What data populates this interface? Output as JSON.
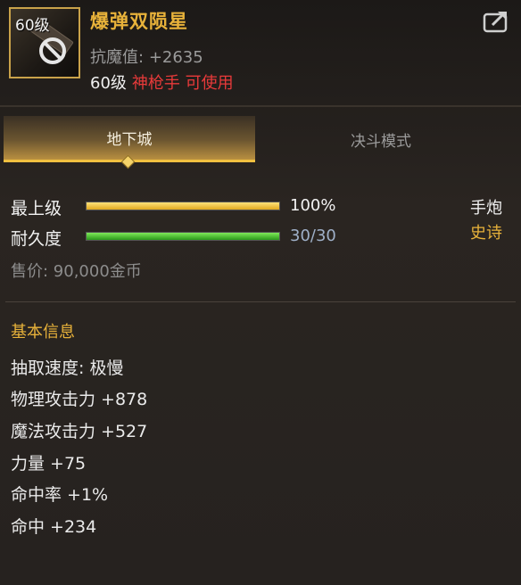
{
  "item": {
    "level_badge": "60级",
    "name": "爆弹双陨星",
    "resist_label": "抗魔值:",
    "resist_value": "+2635",
    "req_level": "60级",
    "req_class": "神枪手 可使用"
  },
  "tabs": [
    {
      "label": "地下城",
      "active": true
    },
    {
      "label": "决斗模式",
      "active": false
    }
  ],
  "stats": {
    "grade_label": "最上级",
    "grade_value": "100%",
    "grade_fraction": 1.0,
    "durability_label": "耐久度",
    "durability_value": "30/30",
    "durability_fraction": 1.0,
    "weapon_type": "手炮",
    "rarity": "史诗",
    "price": "售价: 90,000金币"
  },
  "basic_info": {
    "title": "基本信息",
    "attributes": [
      "抽取速度: 极慢",
      "物理攻击力 +878",
      "魔法攻击力 +527",
      "力量 +75",
      "命中率 +1%",
      "命中 +234"
    ]
  },
  "colors": {
    "name_gold": "#e8b23a",
    "class_red": "#e83a3a",
    "grade_bar": "#f0c63a",
    "durability_bar": "#3fbf2a"
  },
  "icons": [
    "no-entry-icon",
    "share-icon",
    "hand-cannon-icon"
  ]
}
